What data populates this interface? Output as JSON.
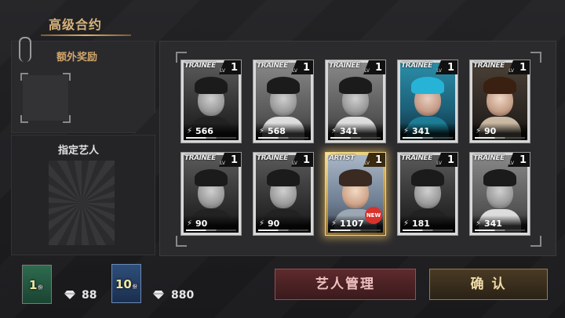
{
  "title": "高级合约",
  "bonus": {
    "label": "额外奖励"
  },
  "artist": {
    "label": "指定艺人"
  },
  "cards": [
    {
      "tag": "TRAINEE",
      "lv_text": "LV",
      "level": "1",
      "power": "566",
      "style": "bw"
    },
    {
      "tag": "TRAINEE",
      "lv_text": "LV",
      "level": "1",
      "power": "568",
      "style": "light"
    },
    {
      "tag": "TRAINEE",
      "lv_text": "LV",
      "level": "1",
      "power": "341",
      "style": "light"
    },
    {
      "tag": "TRAINEE",
      "lv_text": "LV",
      "level": "1",
      "power": "341",
      "style": "teal"
    },
    {
      "tag": "TRAINEE",
      "lv_text": "LV",
      "level": "1",
      "power": "90",
      "style": "warm"
    },
    {
      "tag": "TRAINEE",
      "lv_text": "LV",
      "level": "1",
      "power": "90",
      "style": "bw"
    },
    {
      "tag": "TRAINEE",
      "lv_text": "LV",
      "level": "1",
      "power": "90",
      "style": "bw"
    },
    {
      "tag": "ARTIST",
      "lv_text": "LV",
      "level": "1",
      "power": "1107",
      "style": "gold",
      "badge": "NEW"
    },
    {
      "tag": "TRAINEE",
      "lv_text": "LV",
      "level": "1",
      "power": "181",
      "style": "bw"
    },
    {
      "tag": "TRAINEE",
      "lv_text": "LV",
      "level": "1",
      "power": "341",
      "style": "light"
    }
  ],
  "packs": [
    {
      "count": "1",
      "unit": "份",
      "cost": "88"
    },
    {
      "count": "10",
      "unit": "份",
      "cost": "880"
    }
  ],
  "buttons": {
    "manage": "艺人管理",
    "confirm": "确 认"
  },
  "icons": {
    "power": "lightning-icon",
    "currency": "diamond-icon"
  },
  "colors": {
    "gold": "#d7b37a",
    "manage_border": "#a04a4e",
    "confirm_border": "#9a7a44"
  }
}
